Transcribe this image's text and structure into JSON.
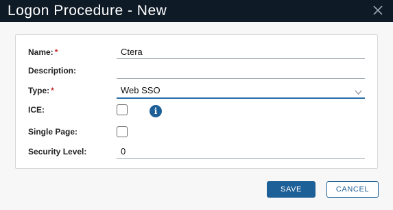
{
  "window": {
    "title": "Logon Procedure - New"
  },
  "form": {
    "name_label": "Name:",
    "name_value": "Ctera",
    "required_mark": "*",
    "description_label": "Description:",
    "description_value": "",
    "type_label": "Type:",
    "type_value": "Web SSO",
    "ice_label": "ICE:",
    "ice_checked": false,
    "single_page_label": "Single Page:",
    "single_page_checked": false,
    "security_level_label": "Security Level:",
    "security_level_value": "0",
    "info_glyph": "i"
  },
  "buttons": {
    "save": "SAVE",
    "cancel": "CANCEL"
  },
  "colors": {
    "titlebar": "#0f1a27",
    "accent": "#1d5f97",
    "required": "#c72b2b"
  },
  "icons": {
    "close": "close-icon",
    "chevron": "chevron-down-icon",
    "info": "info-icon"
  }
}
